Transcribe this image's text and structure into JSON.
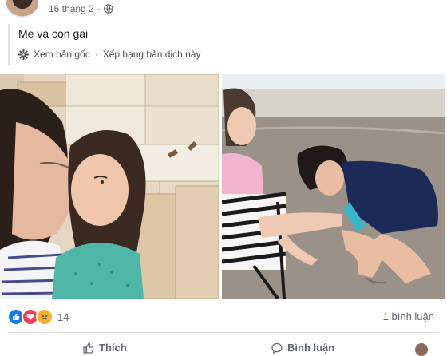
{
  "post": {
    "date": "16 tháng 2",
    "dot": "·",
    "text": "Me va con gai",
    "see_original": "Xem bản gốc",
    "rate_translation": "Xếp hạng bản dịch này"
  },
  "reactions": {
    "types": [
      "like",
      "love",
      "sad"
    ],
    "count": "14",
    "comments": "1 bình luận"
  },
  "actions": {
    "like": "Thích",
    "comment": "Bình luận"
  },
  "colors": {
    "like": "#1877f2",
    "love": "#f33e58",
    "sad": "#f7b125",
    "text_secondary": "#606770"
  }
}
